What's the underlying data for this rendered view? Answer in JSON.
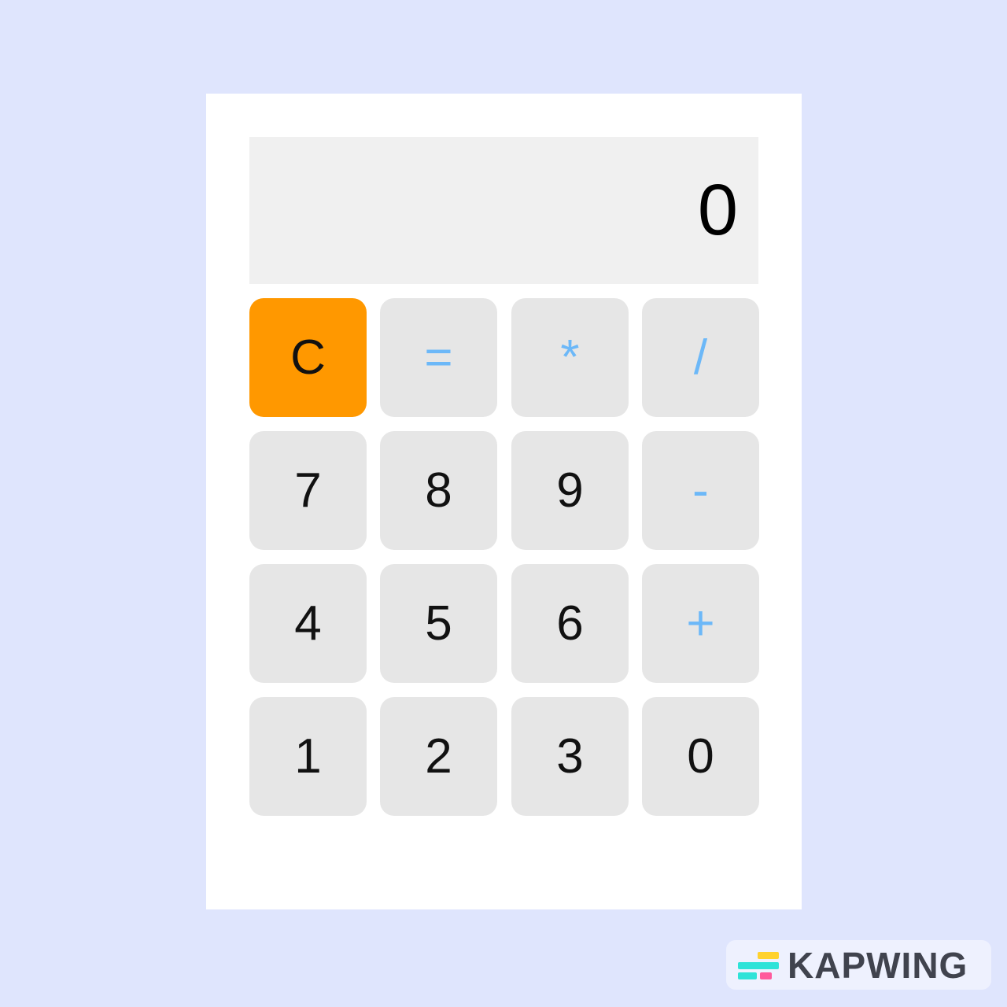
{
  "display": {
    "value": "0"
  },
  "buttons": [
    {
      "label": "C",
      "kind": "clear"
    },
    {
      "label": "=",
      "kind": "op"
    },
    {
      "label": "*",
      "kind": "op"
    },
    {
      "label": "/",
      "kind": "op"
    },
    {
      "label": "7",
      "kind": "num"
    },
    {
      "label": "8",
      "kind": "num"
    },
    {
      "label": "9",
      "kind": "num"
    },
    {
      "label": "-",
      "kind": "op"
    },
    {
      "label": "4",
      "kind": "num"
    },
    {
      "label": "5",
      "kind": "num"
    },
    {
      "label": "6",
      "kind": "num"
    },
    {
      "label": "+",
      "kind": "op"
    },
    {
      "label": "1",
      "kind": "num"
    },
    {
      "label": "2",
      "kind": "num"
    },
    {
      "label": "3",
      "kind": "num"
    },
    {
      "label": "0",
      "kind": "num"
    }
  ],
  "colors": {
    "clear": "#ff9800",
    "operator": "#6cb8f8",
    "key": "#e6e6e6",
    "background": "#dfe5fd"
  },
  "watermark": {
    "text": "KAPWING"
  }
}
